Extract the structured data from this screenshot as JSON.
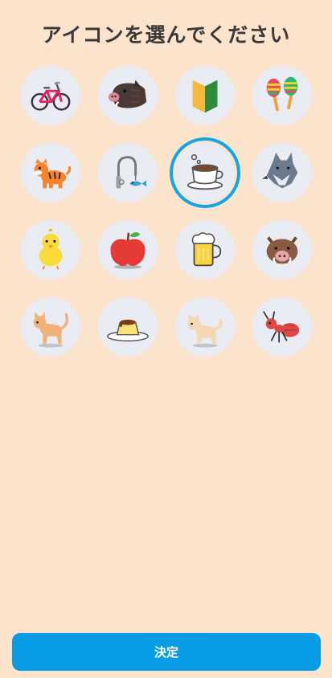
{
  "page": {
    "title": "アイコンを選んでください"
  },
  "icons": [
    {
      "name": "bicycle-icon"
    },
    {
      "name": "boar-head-icon"
    },
    {
      "name": "beginner-mark-icon"
    },
    {
      "name": "maracas-icon"
    },
    {
      "name": "tiger-icon"
    },
    {
      "name": "fishing-rod-icon"
    },
    {
      "name": "coffee-cup-icon",
      "selected": true
    },
    {
      "name": "wolf-icon"
    },
    {
      "name": "chick-icon"
    },
    {
      "name": "apple-icon"
    },
    {
      "name": "beer-mug-icon"
    },
    {
      "name": "wild-boar-face-icon"
    },
    {
      "name": "cat-icon"
    },
    {
      "name": "pudding-icon"
    },
    {
      "name": "dog-icon"
    },
    {
      "name": "ant-icon"
    }
  ],
  "colors": {
    "background": "#fbe3cc",
    "accent": "#089de6",
    "selected_ring": "#13a6e6",
    "icon_bg": "#e9ecf3"
  },
  "actions": {
    "submit_label": "決定"
  }
}
